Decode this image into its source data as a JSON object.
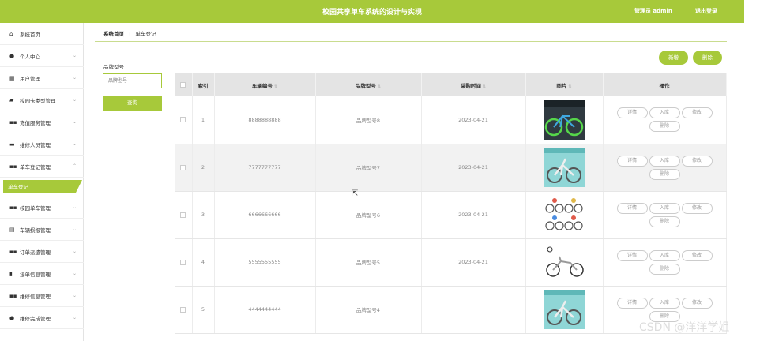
{
  "header": {
    "title": "校园共享单车系统的设计与实现",
    "user": "管理员 admin",
    "logout": "退出登录"
  },
  "sidebar": {
    "items": [
      {
        "label": "系统首页",
        "icon": "home-icon"
      },
      {
        "label": "个人中心",
        "icon": "user-icon"
      },
      {
        "label": "用户管理",
        "icon": "grid-icon"
      },
      {
        "label": "校园卡类型管理",
        "icon": "card-icon"
      },
      {
        "label": "充值服务管理",
        "icon": "apps-icon"
      },
      {
        "label": "维修人员管理",
        "icon": "briefcase-icon"
      },
      {
        "label": "单车登记管理",
        "icon": "apps-icon"
      },
      {
        "label": "校园单车管理",
        "icon": "apps-icon"
      },
      {
        "label": "车辆损报管理",
        "icon": "clipboard-icon"
      },
      {
        "label": "订单派遣管理",
        "icon": "apps-icon"
      },
      {
        "label": "接单信息管理",
        "icon": "bar-chart-icon"
      },
      {
        "label": "维修信息管理",
        "icon": "apps-icon"
      },
      {
        "label": "维修完成管理",
        "icon": "user-icon"
      }
    ],
    "active_sub": "单车登记"
  },
  "breadcrumb": {
    "home": "系统首页",
    "current": "单车登记"
  },
  "search": {
    "label": "品牌型号",
    "placeholder": "品牌型号",
    "button": "查询"
  },
  "actions": {
    "add": "新增",
    "delete": "删除"
  },
  "table": {
    "headers": [
      "索引",
      "车辆编号",
      "品牌型号",
      "采购时间",
      "图片",
      "操作"
    ],
    "rows": [
      {
        "index": "1",
        "bike_no": "8888888888",
        "brand": "品牌型号8",
        "date": "2023-04-21"
      },
      {
        "index": "2",
        "bike_no": "7777777777",
        "brand": "品牌型号7",
        "date": "2023-04-21"
      },
      {
        "index": "3",
        "bike_no": "6666666666",
        "brand": "品牌型号6",
        "date": "2023-04-21"
      },
      {
        "index": "4",
        "bike_no": "5555555555",
        "brand": "品牌型号5",
        "date": "2023-04-21"
      },
      {
        "index": "5",
        "bike_no": "4444444444",
        "brand": "品牌型号4",
        "date": ""
      }
    ],
    "row_buttons": [
      "详情",
      "入库",
      "修改",
      "删除"
    ]
  },
  "watermark": "CSDN @洋洋学姐",
  "colors": {
    "accent": "#a7c93a"
  }
}
